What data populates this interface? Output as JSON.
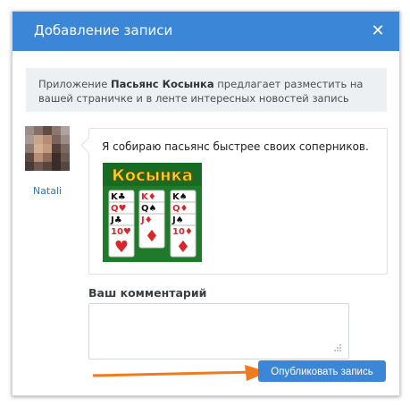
{
  "dialog": {
    "title": "Добавление записи",
    "close_icon": "close-icon"
  },
  "notice": {
    "prefix": "Приложение ",
    "app_name": "Пасьянс Косынка",
    "suffix": " предлагает разместить на вашей страничке и в ленте интересных новостей запись"
  },
  "author": {
    "name": "Natali"
  },
  "post": {
    "text": "Я собираю пасьянс быстрее своих соперников.",
    "image": {
      "title": "Косынка",
      "cards": [
        [
          "K♣",
          "Q♥",
          "J♣",
          "10♥"
        ],
        [
          "K♦",
          "Q♠",
          "J♦"
        ],
        [
          "K♠",
          "Q♦",
          "J♠",
          "10♦"
        ]
      ]
    }
  },
  "comment": {
    "label": "Ваш комментарий",
    "value": "",
    "placeholder": ""
  },
  "actions": {
    "publish_label": "Опубликовать запись"
  },
  "colors": {
    "accent": "#3b86d6",
    "pointer": "#f07a1e",
    "app_green": "#1f7a2a",
    "app_title": "#ffd21a"
  }
}
